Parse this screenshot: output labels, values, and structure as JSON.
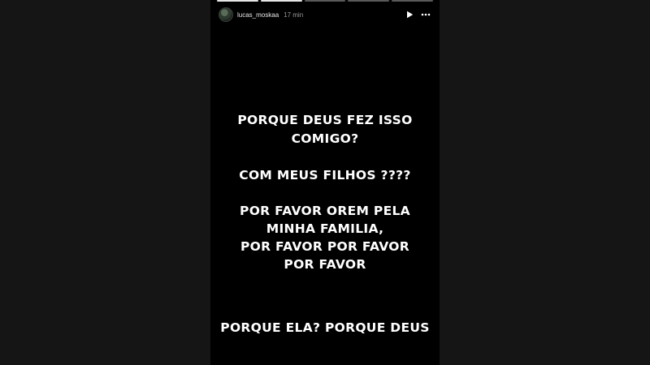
{
  "story": {
    "progress": {
      "segments": 5,
      "active_index": 1
    },
    "header": {
      "username": "lucas_moskaa",
      "time": "17 min",
      "play_icon": "play-icon",
      "more_icon": "more-icon"
    },
    "text_lines": [
      "PORQUE DEUS FEZ ISSO",
      "COMIGO?",
      "COM MEUS FILHOS ????",
      "POR FAVOR OREM PELA",
      "MINHA FAMILIA,",
      "POR FAVOR POR FAVOR",
      "POR FAVOR",
      "PORQUE ELA? PORQUE DEUS"
    ]
  }
}
